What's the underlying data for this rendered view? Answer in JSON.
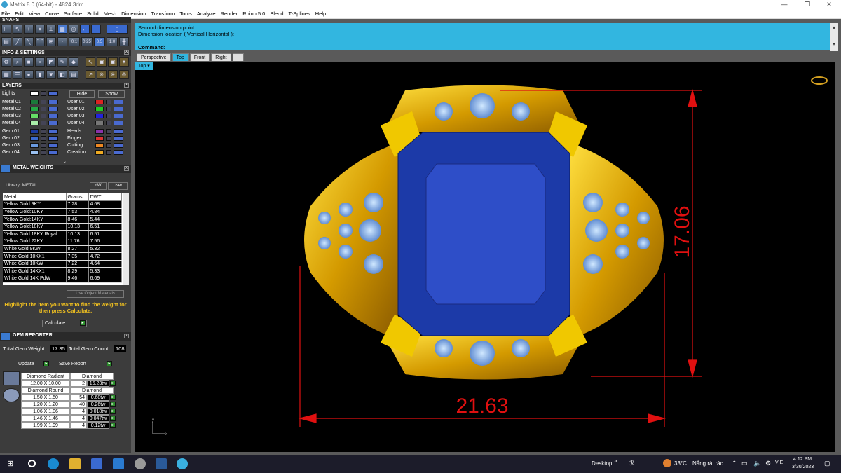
{
  "window": {
    "title": "Matrix 8.0 (64-bit) - 4824.3dm"
  },
  "menu": [
    "File",
    "Edit",
    "View",
    "Curve",
    "Surface",
    "Solid",
    "Mesh",
    "Dimension",
    "Transform",
    "Tools",
    "Analyze",
    "Render",
    "Rhino 5.0",
    "Blend",
    "T-Splines",
    "Help"
  ],
  "panels": {
    "snaps": "SNAPS",
    "info_settings": "INFO & SETTINGS",
    "layers": "LAYERS",
    "metal_weights": "METAL WEIGHTS",
    "gem_reporter": "GEM REPORTER"
  },
  "snap_values": [
    "0.1",
    "0.25",
    "0.5",
    "1.0"
  ],
  "layers": {
    "lights": "Lights",
    "hide": "Hide",
    "show": "Show",
    "left": [
      {
        "name": "Metal 01",
        "color": "#1a7a3a"
      },
      {
        "name": "Metal 02",
        "color": "#22aa44"
      },
      {
        "name": "Metal 03",
        "color": "#66dd66"
      },
      {
        "name": "Metal 04",
        "color": "#aaeeaa"
      },
      {
        "name": "Gem 01",
        "color": "#1a3aa0"
      },
      {
        "name": "Gem 02",
        "color": "#3a6ad0"
      },
      {
        "name": "Gem 03",
        "color": "#6a9ae0"
      },
      {
        "name": "Gem 04",
        "color": "#9ac0f0"
      }
    ],
    "right": [
      {
        "name": "User 01",
        "color": "#dd2222"
      },
      {
        "name": "User 02",
        "color": "#22cc22"
      },
      {
        "name": "User 03",
        "color": "#2222dd"
      },
      {
        "name": "User 04",
        "color": "#777777"
      },
      {
        "name": "Heads",
        "color": "#8833aa"
      },
      {
        "name": "Finger",
        "color": "#dd3333"
      },
      {
        "name": "Cutting",
        "color": "#ee8822"
      },
      {
        "name": "Creation",
        "color": "#eeaa22"
      }
    ]
  },
  "metal_weights": {
    "library_label": "Library: METAL",
    "toggle_a": "dW",
    "toggle_b": "User",
    "headers": [
      "Metal",
      "Grams",
      "DWT"
    ],
    "rows": [
      [
        "Yellow Gold:9KY",
        "7.28",
        "4.68"
      ],
      [
        "Yellow Gold:10KY",
        "7.53",
        "4.84"
      ],
      [
        "Yellow Gold:14KY",
        "8.46",
        "5.44"
      ],
      [
        "Yellow Gold:18KY",
        "10.13",
        "6.51"
      ],
      [
        "Yellow Gold:18KY Royal",
        "10.13",
        "6.51"
      ],
      [
        "Yellow Gold:22KY",
        "11.76",
        "7.56"
      ],
      [
        "White Gold:9KW",
        "8.27",
        "5.32"
      ],
      [
        "White Gold:10KX1",
        "7.35",
        "4.72"
      ],
      [
        "White Gold:10KW",
        "7.22",
        "4.64"
      ],
      [
        "White Gold:14KX1",
        "8.29",
        "5.33"
      ],
      [
        "White Gold:14K PdW",
        "9.46",
        "6.09"
      ]
    ],
    "use_object_materials": "Use Object Materials",
    "hint": "Highlight the item you want to find the weight for then press Calculate.",
    "calculate": "Calculate"
  },
  "gem_reporter": {
    "total_weight_label": "Total Gem Weight",
    "total_weight": "17.35",
    "total_count_label": "Total Gem Count",
    "total_count": "108",
    "update": "Update",
    "save_report": "Save Report",
    "groups": [
      {
        "name": "Diamond Radiant",
        "material": "Diamond",
        "rows": [
          [
            "12.00 X 10.00",
            "2",
            "16.23tw"
          ]
        ]
      },
      {
        "name": "Diamond Round",
        "material": "Diamond",
        "rows": [
          [
            "1.50 X 1.50",
            "54",
            "0.68tw"
          ],
          [
            "1.20 X 1.20",
            "40",
            "0.26tw"
          ],
          [
            "1.06 X 1.06",
            "4",
            "0.018tw"
          ],
          [
            "1.46 X 1.46",
            "4",
            "0.047tw"
          ],
          [
            "1.99 X 1.99",
            "4",
            "0.12tw"
          ]
        ]
      }
    ]
  },
  "command": {
    "history_1": "Second dimension point:",
    "history_2": "Dimension location ( Vertical  Horizontal ):",
    "label": "Command:"
  },
  "viewport_tabs": [
    "Perspective",
    "Top",
    "Front",
    "Right",
    "+"
  ],
  "active_tab": "Top",
  "viewport_label": "Top",
  "dimensions": {
    "width": "21.63",
    "height": "17.06"
  },
  "axis": {
    "x": "x",
    "y": "y"
  },
  "taskbar": {
    "desktop": "Desktop",
    "weather_temp": "33°C",
    "weather_text": "Nắng rải rác",
    "lang": "VIE",
    "time": "4:12 PM",
    "date": "3/30/2023"
  }
}
